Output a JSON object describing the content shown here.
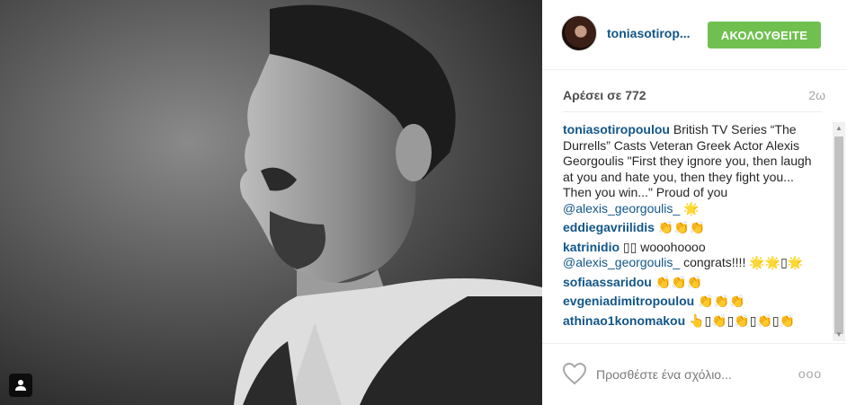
{
  "post": {
    "username": "toniasotirop...",
    "follow_label": "ΑΚΟΛΟΥΘΕΙΤΕ",
    "likes": "Αρέσει σε 772",
    "age": "2ω"
  },
  "comments": [
    {
      "author": "toniasotiropoulou",
      "text": " British TV Series “The Durrells” Casts Veteran Greek Actor Alexis Georgoulis \"First they ignore you, then laugh at you and hate you, then they fight you... Then you win...\" Proud of you ",
      "mention": "@alexis_georgoulis_",
      "tail": " 🌟"
    },
    {
      "author": "eddiegavriilidis",
      "text": " 👏👏👏",
      "mention": "",
      "tail": ""
    },
    {
      "author": "katrinidio",
      "text": " ▯▯ wooohoooo ",
      "mention": "@alexis_georgoulis_",
      "tail": " congrats!!!! 🌟🌟▯🌟"
    },
    {
      "author": "sofiaassaridou",
      "text": " 👏👏👏",
      "mention": "",
      "tail": ""
    },
    {
      "author": "evgeniadimitropoulou",
      "text": " 👏👏👏",
      "mention": "",
      "tail": ""
    },
    {
      "author": "athinao1konomakou",
      "text": " 👆▯👏▯👏▯👏▯👏",
      "mention": "",
      "tail": ""
    }
  ],
  "comment_box": {
    "placeholder": "Προσθέστε ένα σχόλιο...",
    "more_label": "ooo"
  },
  "icons": {
    "user_tag": "person-icon",
    "like": "heart-outline-icon",
    "more": "ellipsis-icon"
  },
  "colors": {
    "follow_button": "#70c050",
    "link": "#125688",
    "muted": "#a5a7aa"
  }
}
